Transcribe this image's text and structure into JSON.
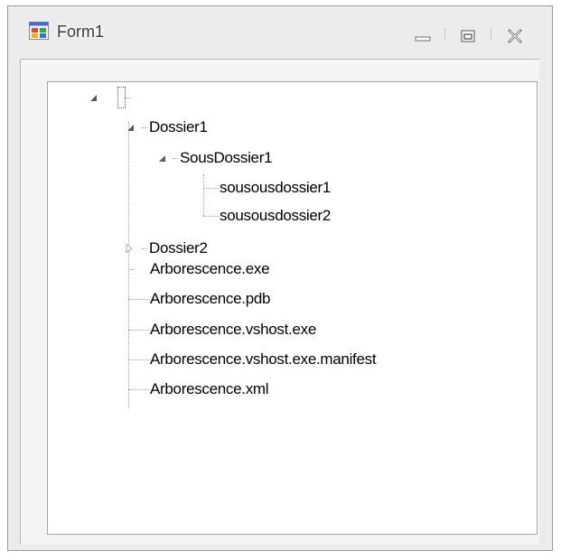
{
  "window": {
    "title": "Form1",
    "icon": "winforms-app-icon",
    "controls": [
      "minimize-icon",
      "maximize-icon",
      "close-icon"
    ]
  },
  "tree": {
    "root": {
      "label": "",
      "expanded": true,
      "focused": true
    },
    "nodes": [
      {
        "label": "Dossier1",
        "expanded": true
      },
      {
        "label": "SousDossier1",
        "expanded": true
      },
      {
        "label": "sousousdossier1"
      },
      {
        "label": "sousousdossier2"
      },
      {
        "label": "Dossier2",
        "expanded": false
      },
      {
        "label": "Arborescence.exe"
      },
      {
        "label": "Arborescence.pdb"
      },
      {
        "label": "Arborescence.vshost.exe"
      },
      {
        "label": "Arborescence.vshost.exe.manifest"
      },
      {
        "label": "Arborescence.xml"
      }
    ]
  },
  "colors": {
    "window_bg": "#ececec",
    "tree_bg": "#ffffff",
    "tree_lines": "#a0a0a0",
    "expander": "#595959"
  }
}
